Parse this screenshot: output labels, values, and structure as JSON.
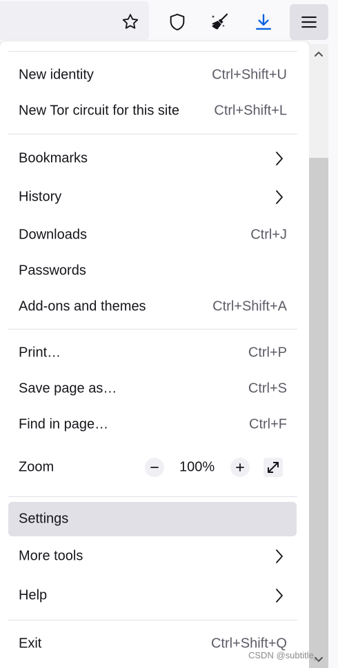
{
  "toolbar": {
    "icons": [
      "star-icon",
      "shield-icon",
      "broom-icon",
      "download-icon",
      "hamburger-menu-icon"
    ],
    "accent": "#0061e0"
  },
  "menu": {
    "new_identity": {
      "label": "New identity",
      "shortcut": "Ctrl+Shift+U"
    },
    "new_circuit": {
      "label": "New Tor circuit for this site",
      "shortcut": "Ctrl+Shift+L"
    },
    "bookmarks": {
      "label": "Bookmarks"
    },
    "history": {
      "label": "History"
    },
    "downloads": {
      "label": "Downloads",
      "shortcut": "Ctrl+J"
    },
    "passwords": {
      "label": "Passwords"
    },
    "addons": {
      "label": "Add-ons and themes",
      "shortcut": "Ctrl+Shift+A"
    },
    "print": {
      "label": "Print…",
      "shortcut": "Ctrl+P"
    },
    "save_page": {
      "label": "Save page as…",
      "shortcut": "Ctrl+S"
    },
    "find": {
      "label": "Find in page…",
      "shortcut": "Ctrl+F"
    },
    "zoom": {
      "label": "Zoom",
      "value": "100%"
    },
    "settings": {
      "label": "Settings"
    },
    "more_tools": {
      "label": "More tools"
    },
    "help": {
      "label": "Help"
    },
    "exit": {
      "label": "Exit",
      "shortcut": "Ctrl+Shift+Q"
    }
  },
  "watermark": "CSDN @subtitle_",
  "colors": {
    "hover": "#e0e0e6",
    "separator": "#e0e0e6",
    "shortcut_text": "#5b5b66"
  }
}
